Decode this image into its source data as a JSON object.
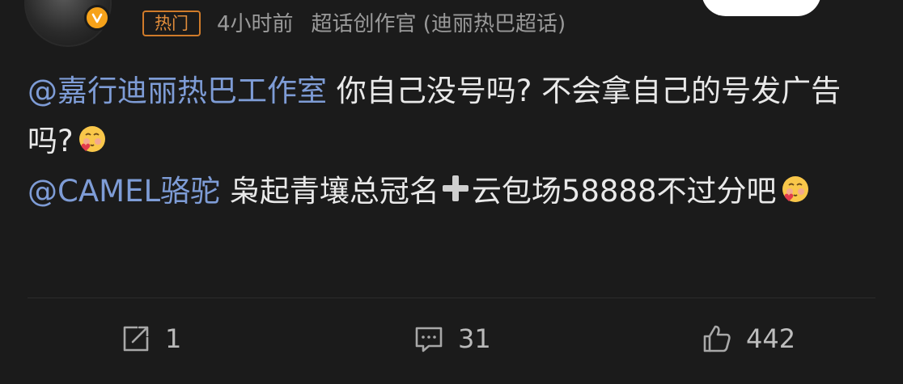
{
  "author": {
    "avatar_hint": "9"
  },
  "meta": {
    "hot_tag": "热门",
    "time": "4小时前",
    "source": "超话创作官 (迪丽热巴超话)"
  },
  "content": {
    "line1_mention": "@嘉行迪丽热巴工作室",
    "line1_text": " 你自己没号吗? 不会拿自己的号发广告吗?",
    "line2_mention": "@CAMEL骆驼",
    "line2_text_a": " 枭起青壤总冠名",
    "line2_text_b": "云包场58888不过分吧"
  },
  "actions": {
    "share_count": "1",
    "comment_count": "31",
    "like_count": "442"
  },
  "colors": {
    "background": "#1b1b1b",
    "mention": "#7e9cd6",
    "hot_tag": "#e28d3b",
    "verify_badge": "#f6a21a"
  },
  "icons": {
    "verify": "verified-v-icon",
    "emoji": "blushing-heart-emoji",
    "plus": "plus-emoji",
    "share": "share-icon",
    "comment": "comment-icon",
    "like": "thumbs-up-icon"
  }
}
